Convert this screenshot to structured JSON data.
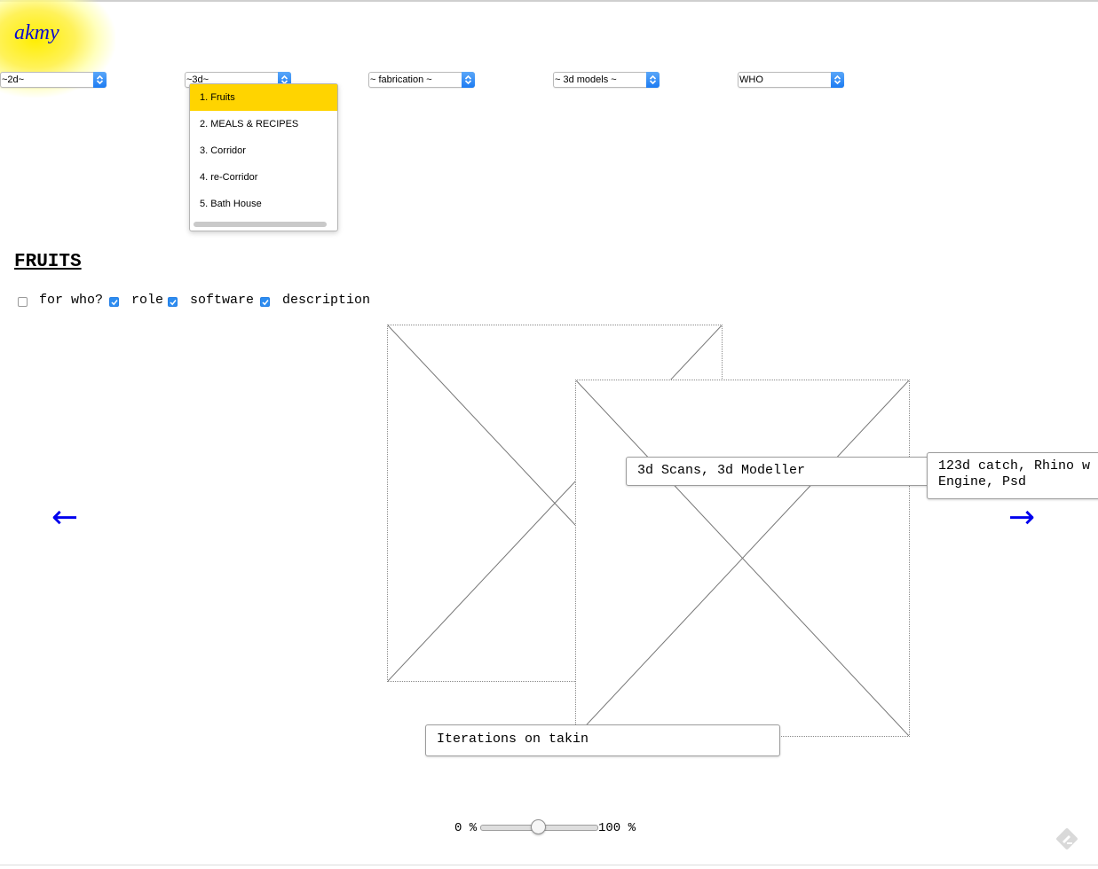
{
  "site": {
    "logo": "akmy"
  },
  "nav": {
    "selects": [
      {
        "value": "~2d~"
      },
      {
        "value": "~3d~"
      },
      {
        "value": "~ fabrication ~"
      },
      {
        "value": "~ 3d models ~"
      },
      {
        "value": "WHO"
      }
    ],
    "open_dropdown": {
      "items": [
        "1. Fruits",
        "2. MEALS & RECIPES",
        "3. Corridor",
        "4. re-Corridor",
        "5. Bath House"
      ],
      "selected_index": 0,
      "highlight_color": "#ffd400"
    }
  },
  "project": {
    "title": "FRUITS",
    "filters": [
      {
        "label": "for who?",
        "checked": false
      },
      {
        "label": "role",
        "checked": true
      },
      {
        "label": "software",
        "checked": true
      },
      {
        "label": "description",
        "checked": true
      }
    ],
    "captions": {
      "role": "3d Scans, 3d Modeller",
      "software_line1": "123d catch, Rhino w",
      "software_line2": "Engine, Psd",
      "description": "Iterations on takin"
    }
  },
  "navigation": {
    "prev": "←",
    "next": "→",
    "link_color": "#0000ee"
  },
  "zoom": {
    "min_label": "0 %",
    "max_label": "100 %",
    "value_fraction": 0.5
  },
  "icons": {
    "corner": "feedback-pencil-icon"
  }
}
